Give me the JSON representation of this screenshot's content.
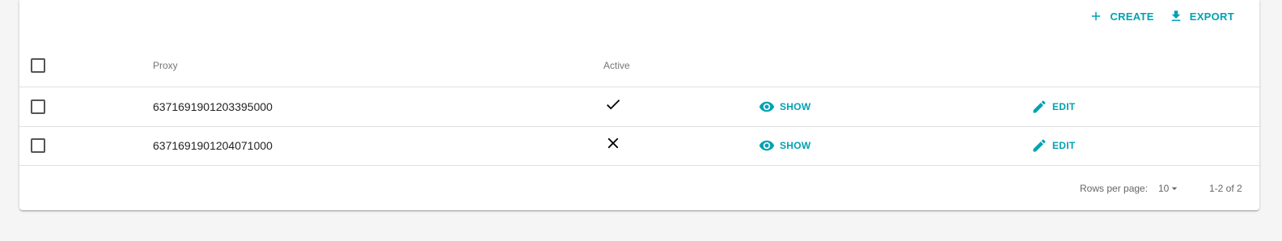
{
  "toolbar": {
    "create_label": "CREATE",
    "export_label": "EXPORT"
  },
  "table": {
    "columns": [
      "Proxy",
      "Active"
    ],
    "rows": [
      {
        "proxy": "6371691901203395000",
        "active": "check-icon",
        "show_label": "SHOW",
        "edit_label": "EDIT"
      },
      {
        "proxy": "6371691901204071000",
        "active": "close-icon",
        "show_label": "SHOW",
        "edit_label": "EDIT"
      }
    ]
  },
  "pagination": {
    "rows_per_page_label": "Rows per page:",
    "rows_per_page_value": "10",
    "range": "1-2 of 2"
  },
  "colors": {
    "accent": "#00a2b2",
    "background": "#f5f5f5"
  }
}
